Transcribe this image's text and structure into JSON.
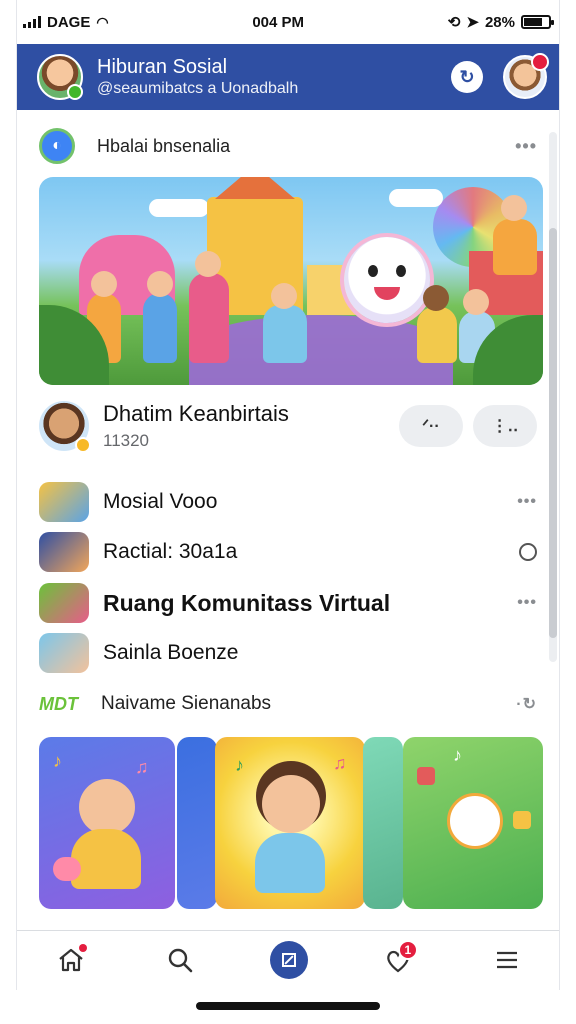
{
  "status_bar": {
    "carrier": "DAGE",
    "time": "004 PM",
    "battery": "28%"
  },
  "header": {
    "title": "Hiburan Sosial",
    "handle": "@seaumibatcs a Uonadbalh",
    "action_icon": "refresh-icon"
  },
  "community": {
    "label": "Hbalai bnsenalia",
    "icon": "community-icon"
  },
  "post": {
    "name": "Dhatim Keanbirtais",
    "count": "11320",
    "action_a": "ᐟ··",
    "action_b": "⋮‥"
  },
  "list_items": [
    {
      "label": "Mosial Vooo",
      "action": "•••"
    },
    {
      "label": "Ractial: 30a1a",
      "action": "ring"
    },
    {
      "label": "Ruang Komunitass Virtual",
      "action": "•••"
    },
    {
      "label": "Sainla Boenze",
      "action": ""
    }
  ],
  "nav_section": {
    "badge": "MDT",
    "label": "Naivame Sienanabs",
    "action": "·↻"
  },
  "tab_bar": {
    "items": [
      "home-icon",
      "search-icon",
      "compose-icon",
      "notifications-icon",
      "menu-icon"
    ],
    "notification_count": "1"
  },
  "colors": {
    "brand": "#2f4fa3",
    "alert": "#e41e3f",
    "accent_green": "#6bc23a"
  }
}
